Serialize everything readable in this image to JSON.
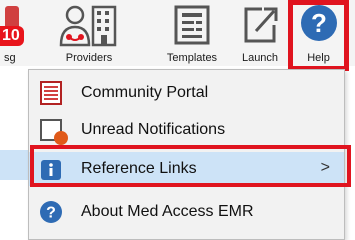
{
  "toolbar": {
    "badge_count": "10",
    "items": [
      {
        "label": "sg",
        "icon": "messages-icon"
      },
      {
        "label": "Providers",
        "icon": "providers-icon"
      },
      {
        "label": "Templates",
        "icon": "templates-icon"
      },
      {
        "label": "Launch",
        "icon": "launch-icon"
      },
      {
        "label": "Help",
        "icon": "help-icon"
      }
    ]
  },
  "menu": {
    "items": [
      {
        "label": "Community Portal",
        "icon": "document-icon"
      },
      {
        "label": "Unread Notifications",
        "icon": "notification-icon"
      },
      {
        "label": "Reference Links",
        "icon": "info-icon",
        "submenu_indicator": ">"
      },
      {
        "label": "About Med Access EMR",
        "icon": "question-icon"
      }
    ]
  },
  "colors": {
    "highlight": "#cde3f7",
    "callout_red": "#e0141f",
    "help_blue": "#2e6bb4"
  }
}
